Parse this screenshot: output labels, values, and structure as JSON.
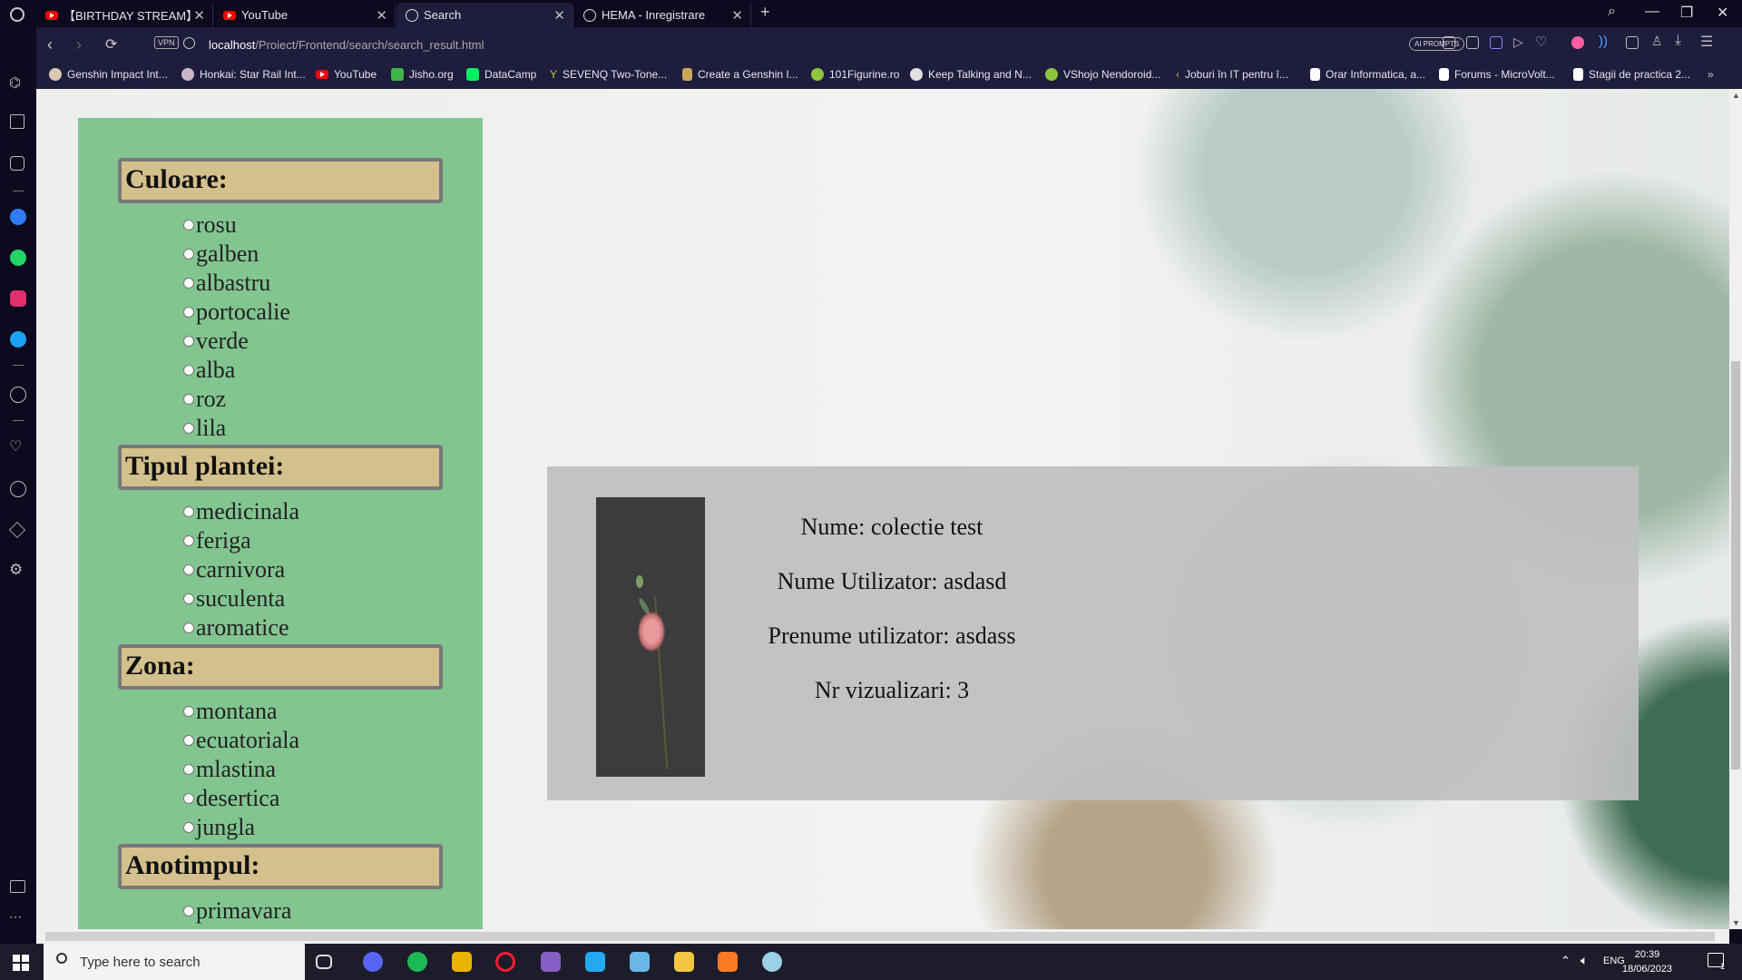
{
  "browser": {
    "tabs": [
      {
        "label": "【BIRTHDAY STREAM】Let's",
        "icon": "youtube-icon"
      },
      {
        "label": "YouTube",
        "icon": "youtube-icon"
      },
      {
        "label": "Search",
        "icon": "globe-icon"
      },
      {
        "label": "HEMA - Inregistrare",
        "icon": "globe-icon"
      }
    ],
    "new_tab": "+",
    "vpn_label": "VPN",
    "url_host": "localhost",
    "url_path": "/Proiect/Frontend/search/search_result.html",
    "ai_prompts": "AI PROMPTS"
  },
  "bookmarks": [
    {
      "label": "Genshin Impact Int...",
      "color": "#d9c9b0"
    },
    {
      "label": "Honkai: Star Rail Int...",
      "color": "#c8b6c9"
    },
    {
      "label": "YouTube",
      "color": "#ff0000"
    },
    {
      "label": "Jisho.org",
      "color": "#3fb54a"
    },
    {
      "label": "DataCamp",
      "color": "#03ef62"
    },
    {
      "label": "SEVENQ Two-Tone...",
      "color": "#c9c93a"
    },
    {
      "label": "Create a Genshin I...",
      "color": "#c9a65a"
    },
    {
      "label": "101Figurine.ro",
      "color": "#8fc43c"
    },
    {
      "label": "Keep Talking and N...",
      "color": "#e0e0e0"
    },
    {
      "label": "VShojo Nendoroid...",
      "color": "#8fc43c"
    },
    {
      "label": "Joburi în IT pentru î...",
      "color": "#d9a23c"
    },
    {
      "label": "Orar Informatica, a...",
      "color": "#ffffff"
    },
    {
      "label": "Forums - MicroVolt...",
      "color": "#ffffff"
    },
    {
      "label": "Stagii de practica 2...",
      "color": "#ffffff"
    }
  ],
  "filters": {
    "sections": [
      {
        "title": "Culoare:",
        "options": [
          "rosu",
          "galben",
          "albastru",
          "portocalie",
          "verde",
          "alba",
          "roz",
          "lila"
        ]
      },
      {
        "title": "Tipul plantei:",
        "options": [
          "medicinala",
          "feriga",
          "carnivora",
          "suculenta",
          "aromatice"
        ]
      },
      {
        "title": "Zona:",
        "options": [
          "montana",
          "ecuatoriala",
          "mlastina",
          "desertica",
          "jungla"
        ]
      },
      {
        "title": "Anotimpul:",
        "options": [
          "primavara"
        ]
      }
    ]
  },
  "result": {
    "nume": "Nume: colectie test",
    "utilizator": "Nume Utilizator: asdasd",
    "prenume": "Prenume utilizator: asdass",
    "vizualizari": "Nr vizualizari: 3"
  },
  "taskbar": {
    "search_placeholder": "Type here to search",
    "language": "ENG",
    "time": "20:39",
    "date": "18/06/2023",
    "notification_count": "1"
  }
}
